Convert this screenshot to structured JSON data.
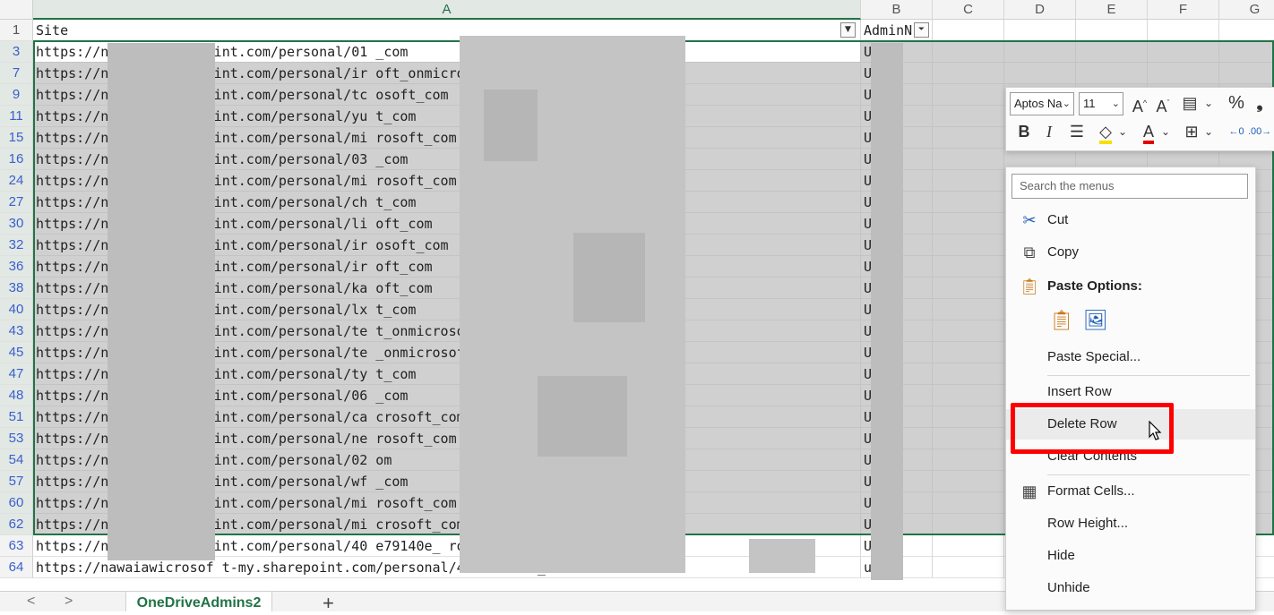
{
  "columns": [
    {
      "label": "A",
      "selected": true
    },
    {
      "label": "B",
      "selected": false
    },
    {
      "label": "C",
      "selected": false
    },
    {
      "label": "D",
      "selected": false
    },
    {
      "label": "E",
      "selected": false
    },
    {
      "label": "F",
      "selected": false
    },
    {
      "label": "G",
      "selected": false
    }
  ],
  "header_row": {
    "num": "1",
    "a": "Site",
    "b": "AdminN   e"
  },
  "rows": [
    {
      "num": "3",
      "a": "https://n          t-my.sharepoint.com/personal/01                             _com",
      "b": "U"
    },
    {
      "num": "7",
      "a": "https://n          t-my.sharepoint.com/personal/ir                             oft_onmicrosoft_com",
      "b": "U"
    },
    {
      "num": "9",
      "a": "https://n          t-my.sharepoint.com/personal/tc                             osoft_com",
      "b": "U"
    },
    {
      "num": "11",
      "a": "https://n          t-my.sharepoint.com/personal/yu                             t_com",
      "b": "U"
    },
    {
      "num": "15",
      "a": "https://n          t-my.sharepoint.com/personal/mi                             rosoft_com",
      "b": "U"
    },
    {
      "num": "16",
      "a": "https://n          t-my.sharepoint.com/personal/03                             _com",
      "b": "U"
    },
    {
      "num": "24",
      "a": "https://n          t-my.sharepoint.com/personal/mi                             rosoft_com",
      "b": "U"
    },
    {
      "num": "27",
      "a": "https://n          t-my.sharepoint.com/personal/ch                             t_com",
      "b": "U"
    },
    {
      "num": "30",
      "a": "https://n          t-my.sharepoint.com/personal/li                             oft_com",
      "b": "U"
    },
    {
      "num": "32",
      "a": "https://n          t-my.sharepoint.com/personal/ir                             osoft_com",
      "b": "U"
    },
    {
      "num": "36",
      "a": "https://n          t-my.sharepoint.com/personal/ir                             oft_com",
      "b": "U"
    },
    {
      "num": "38",
      "a": "https://n          t-my.sharepoint.com/personal/ka                             oft_com",
      "b": "U"
    },
    {
      "num": "40",
      "a": "https://n          t-my.sharepoint.com/personal/lx                             t_com",
      "b": "U"
    },
    {
      "num": "43",
      "a": "https://n          t-my.sharepoint.com/personal/te                             t_onmicrosoft_com",
      "b": "U"
    },
    {
      "num": "45",
      "a": "https://n          t-my.sharepoint.com/personal/te                             _onmicrosoft_com",
      "b": "U"
    },
    {
      "num": "47",
      "a": "https://n          t-my.sharepoint.com/personal/ty                             t_com",
      "b": "U"
    },
    {
      "num": "48",
      "a": "https://n          t-my.sharepoint.com/personal/06                             _com",
      "b": "U"
    },
    {
      "num": "51",
      "a": "https://n          t-my.sharepoint.com/personal/ca                             crosoft_com",
      "b": "U"
    },
    {
      "num": "53",
      "a": "https://n          t-my.sharepoint.com/personal/ne                             rosoft_com",
      "b": "U"
    },
    {
      "num": "54",
      "a": "https://n          t-my.sharepoint.com/personal/02                             om",
      "b": "U"
    },
    {
      "num": "57",
      "a": "https://n          t-my.sharepoint.com/personal/wf                             _com",
      "b": "U"
    },
    {
      "num": "60",
      "a": "https://n          t-my.sharepoint.com/personal/mi                             rosoft_com",
      "b": "U"
    },
    {
      "num": "62",
      "a": "https://n          t-my.sharepoint.com/personal/mi                             crosoft_com",
      "b": "U"
    },
    {
      "num": "63",
      "a": "https://n          t-my.sharepoint.com/personal/40                             e79140e_        rosof",
      "b": "U"
    },
    {
      "num": "64",
      "a": "https://nawaiawicrosof t-my.sharepoint.com/personal/40                             e79140e_        rosof",
      "b": "u"
    }
  ],
  "sheet_tab": {
    "name": "OneDriveAdmins2",
    "prev": "<",
    "next": ">",
    "add": "+"
  },
  "mini_toolbar": {
    "font_name": "Aptos Na",
    "font_size": "11",
    "percent": "%"
  },
  "context_menu": {
    "search_placeholder": "Search the menus",
    "cut": "Cut",
    "copy": "Copy",
    "paste_options": "Paste Options:",
    "paste_special": "Paste Special...",
    "insert_row": "Insert Row",
    "delete_row": "Delete Row",
    "clear_contents": "Clear Contents",
    "format_cells": "Format Cells...",
    "row_height": "Row Height...",
    "hide": "Hide",
    "unhide": "Unhide"
  },
  "colors": {
    "accent": "#217346",
    "highlight": "#ff0000",
    "selection": "#d0d0d0",
    "rownum": "#3a5fcd"
  }
}
